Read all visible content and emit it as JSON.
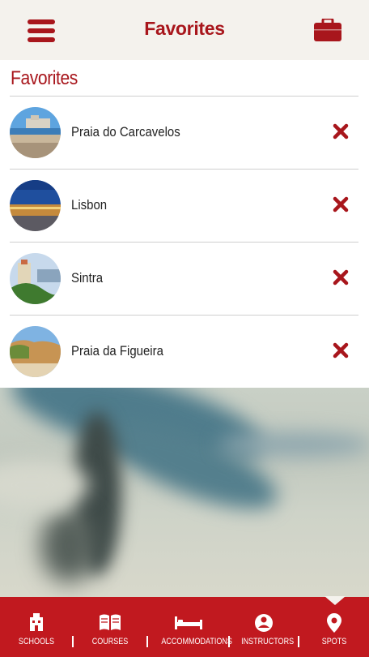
{
  "header": {
    "title": "Favorites",
    "menu_icon": "hamburger-menu-icon",
    "right_icon": "briefcase-icon"
  },
  "section_title": "Favorites",
  "favorites": [
    {
      "label": "Praia do Carcavelos",
      "thumb": "beach-fort-photo"
    },
    {
      "label": "Lisbon",
      "thumb": "city-night-photo"
    },
    {
      "label": "Sintra",
      "thumb": "palace-photo"
    },
    {
      "label": "Praia da Figueira",
      "thumb": "cliff-beach-photo"
    }
  ],
  "nav": {
    "tabs": [
      {
        "label": "SCHOOLS",
        "icon": "school-icon"
      },
      {
        "label": "COURSES",
        "icon": "book-icon"
      },
      {
        "label": "ACCOMMODATIONS",
        "icon": "bed-icon"
      },
      {
        "label": "INSTRUCTORS",
        "icon": "instructor-icon"
      },
      {
        "label": "SPOTS",
        "icon": "map-pin-icon"
      }
    ],
    "active": "SPOTS"
  },
  "colors": {
    "accent": "#a8161c",
    "nav_bg": "#c1191f",
    "header_bg": "#f4f2ed"
  }
}
